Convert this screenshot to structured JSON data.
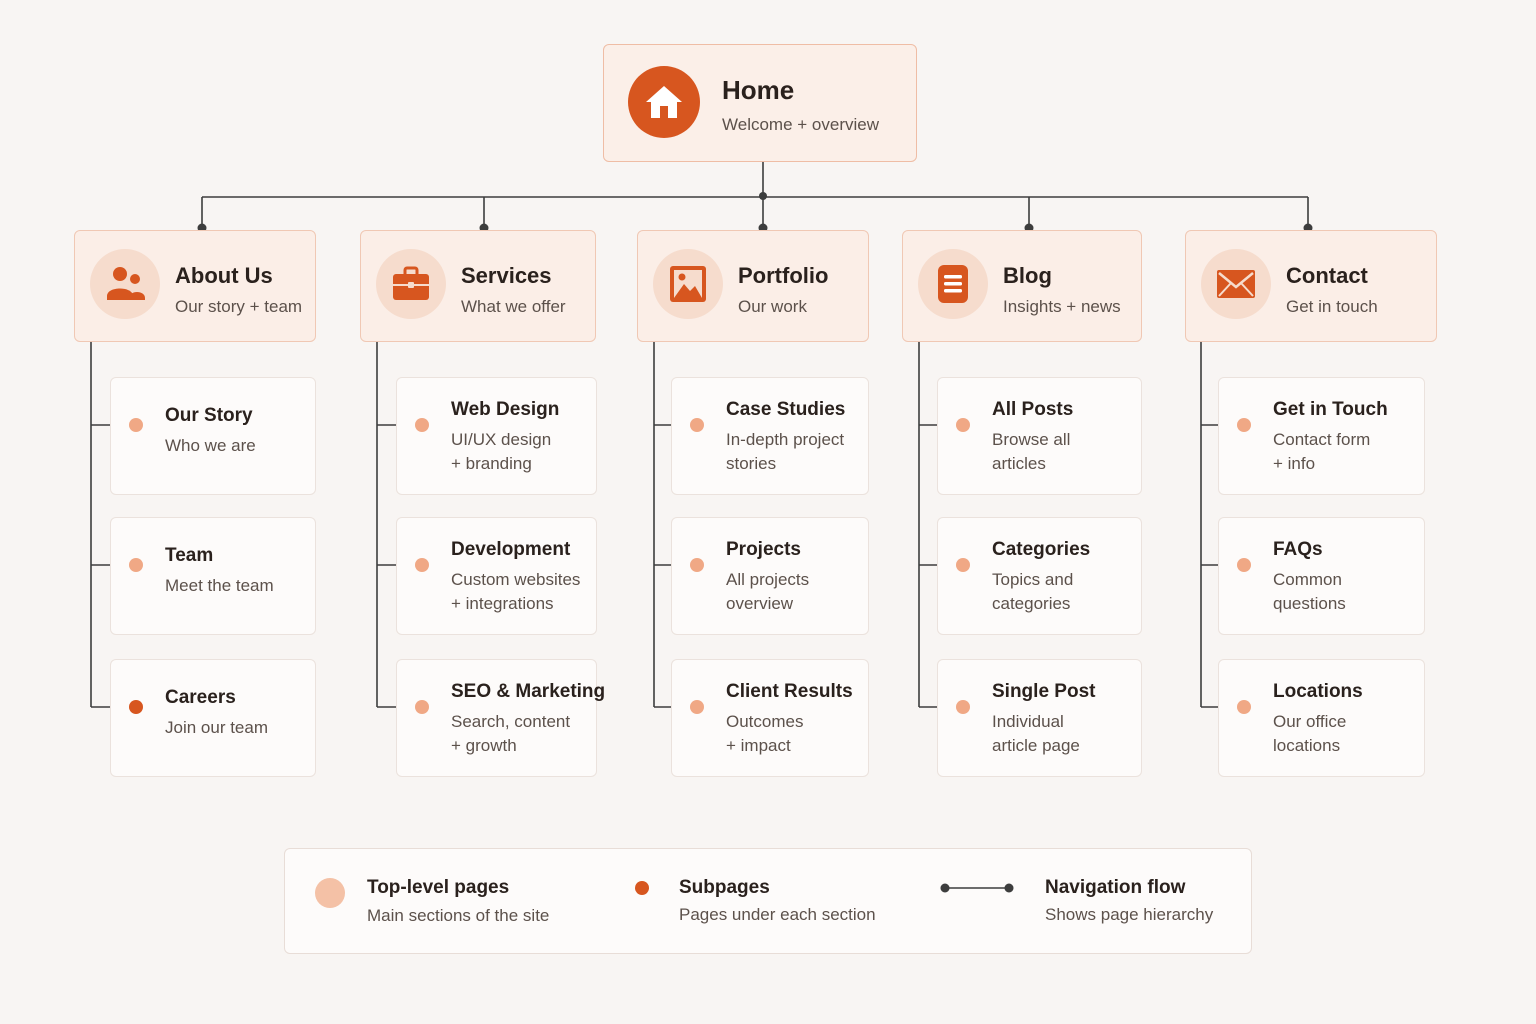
{
  "home": {
    "title": "Home",
    "subtitle": "Welcome + overview",
    "icon": "house-icon"
  },
  "sections": [
    {
      "title": "About Us",
      "subtitle": "Our story + team",
      "icon": "people-icon",
      "pages": [
        {
          "title": "Our Story",
          "desc": "Who we are",
          "dot": "light"
        },
        {
          "title": "Team",
          "desc": "Meet the team",
          "dot": "light"
        },
        {
          "title": "Careers",
          "desc": "Join our team",
          "dot": "dark"
        }
      ]
    },
    {
      "title": "Services",
      "subtitle": "What we offer",
      "icon": "briefcase-icon",
      "pages": [
        {
          "title": "Web Design",
          "desc": "UI/UX design\n+ branding",
          "dot": "light"
        },
        {
          "title": "Development",
          "desc": "Custom websites\n+ integrations",
          "dot": "light"
        },
        {
          "title": "SEO & Marketing",
          "desc": "Search, content\n+ growth",
          "dot": "light"
        }
      ]
    },
    {
      "title": "Portfolio",
      "subtitle": "Our work",
      "icon": "image-icon",
      "pages": [
        {
          "title": "Case Studies",
          "desc": "In-depth project\nstories",
          "dot": "light"
        },
        {
          "title": "Projects",
          "desc": "All projects\noverview",
          "dot": "light"
        },
        {
          "title": "Client Results",
          "desc": "Outcomes\n+ impact",
          "dot": "light"
        }
      ]
    },
    {
      "title": "Blog",
      "subtitle": "Insights + news",
      "icon": "document-icon",
      "pages": [
        {
          "title": "All Posts",
          "desc": "Browse all\narticles",
          "dot": "light"
        },
        {
          "title": "Categories",
          "desc": "Topics and\ncategories",
          "dot": "light"
        },
        {
          "title": "Single Post",
          "desc": "Individual\narticle page",
          "dot": "light"
        }
      ]
    },
    {
      "title": "Contact",
      "subtitle": "Get in touch",
      "icon": "envelope-icon",
      "pages": [
        {
          "title": "Get in Touch",
          "desc": "Contact form\n+ info",
          "dot": "light"
        },
        {
          "title": "FAQs",
          "desc": "Common\nquestions",
          "dot": "light"
        },
        {
          "title": "Locations",
          "desc": "Our office\nlocations",
          "dot": "light"
        }
      ]
    }
  ],
  "legend": {
    "top_level": {
      "title": "Top-level pages",
      "subtitle": "Main sections of the site"
    },
    "subpages": {
      "title": "Subpages",
      "subtitle": "Pages under each section"
    },
    "navigation": {
      "title": "Navigation flow",
      "subtitle": "Shows page hierarchy"
    }
  },
  "colors": {
    "accent": "#d7561f",
    "accent_light": "#f0a885",
    "card_tint": "#fbeee7",
    "line": "#3a3a3a"
  }
}
